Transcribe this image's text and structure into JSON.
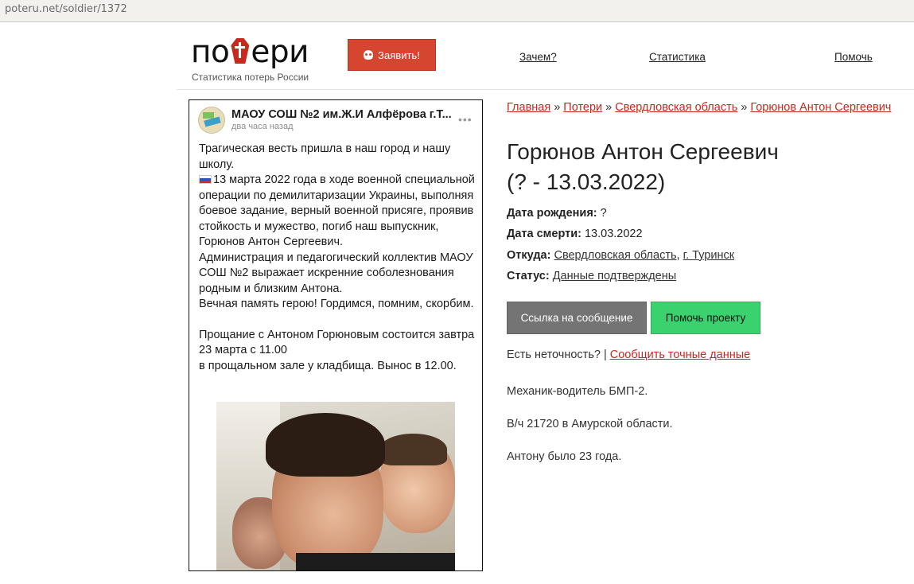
{
  "browser": {
    "url": "poteru.net/soldier/1372"
  },
  "header": {
    "logo_left": "по",
    "logo_right": "ери",
    "logo_subtitle": "Статистика потерь России",
    "declare_label": "Заявить!",
    "nav": [
      "Зачем?",
      "Статистика",
      "Помочь"
    ]
  },
  "post": {
    "author": "МАОУ СОШ №2 им.Ж.И Алфёрова г.Т...",
    "time": "два часа назад",
    "more": "•••",
    "paragraphs": [
      "Трагическая весть пришла в наш город и нашу школу.",
      "13 марта 2022 года в ходе военной специальной операции по демилитаризации Украины, выполняя боевое задание, верный военной присяге, проявив стойкость и мужество, погиб наш выпускник, Горюнов Антон Сергеевич.",
      "Администрация и педагогический коллектив МАОУ СОШ №2 выражает искренние соболезнования родным и близким Антона.\n Вечная память герою! Гордимся, помним, скорбим.",
      "Прощание с Антоном Горюновым состоится завтра 23 марта с 11.00\nв прощальном зале у кладбища. Вынос в 12.00."
    ]
  },
  "breadcrumb": {
    "items": [
      "Главная",
      "Потери",
      "Свердловская область",
      "Горюнов Антон Сергеевич"
    ],
    "separator": "»"
  },
  "person": {
    "name": "Горюнов Антон Сергеевич",
    "dates": "(? - 13.03.2022)",
    "birth_label": "Дата рождения:",
    "birth_value": "?",
    "death_label": "Дата смерти:",
    "death_value": "13.03.2022",
    "from_label": "Откуда:",
    "from_region": "Свердловская область",
    "from_city": "г. Туринск",
    "status_label": "Статус:",
    "status_value": "Данные подтверждены"
  },
  "actions": {
    "link_button": "Ссылка на сообщение",
    "help_button": "Помочь проекту",
    "inaccuracy_text": "Есть неточность?",
    "inaccuracy_link": "Сообщить точные данные"
  },
  "bio": [
    "Механик-водитель БМП-2.",
    "В/ч 21720 в Амурской области.",
    "Антону было 23 года."
  ],
  "colors": {
    "accent_red": "#c8281e",
    "declare_button": "#d6452f",
    "help_green": "#3ad16f",
    "link_button_gray": "#747474"
  }
}
